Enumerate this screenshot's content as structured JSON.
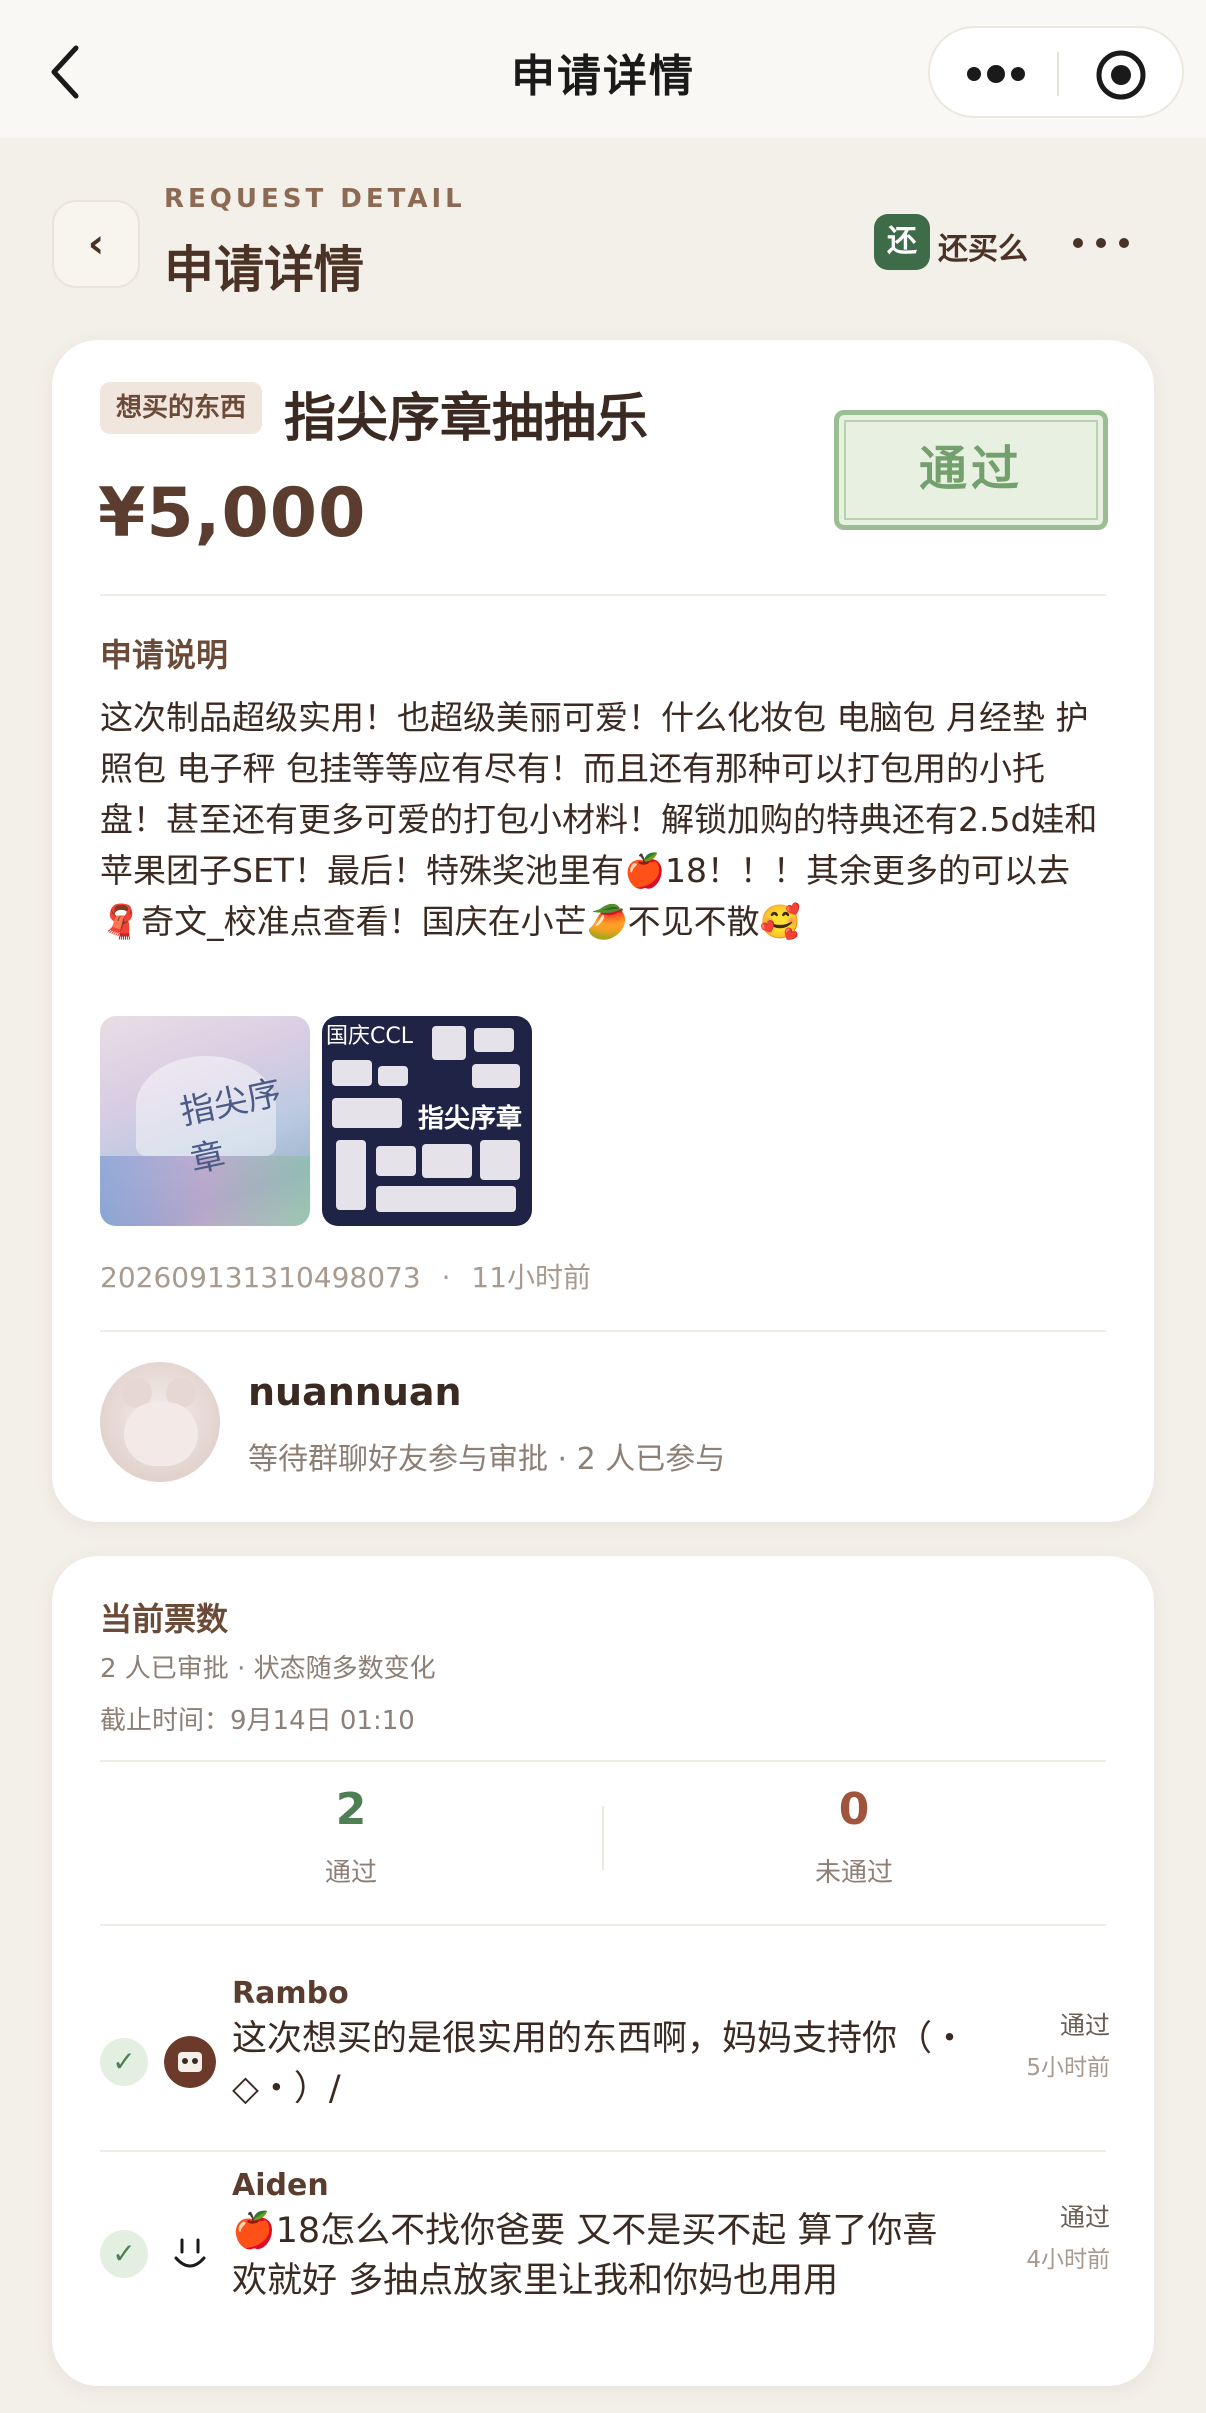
{
  "topnav": {
    "title": "申请详情"
  },
  "header": {
    "subtitle": "REQUEST DETAIL",
    "title": "申请详情",
    "back_label": "‹",
    "app_badge": "还",
    "app_name": "还买么"
  },
  "request": {
    "tag": "想买的东西",
    "item_name": "指尖序章抽抽乐",
    "price": "¥5,000",
    "stamp": "通过",
    "section_label": "申请说明",
    "description": "这次制品超级实用！也超级美丽可爱！什么化妆包 电脑包 月经垫 护照包 电子秤 包挂等等应有尽有！而且还有那种可以打包用的小托盘！甚至还有更多可爱的打包小材料！解锁加购的特典还有2.5d娃和苹果团子SET！最后！特殊奖池里有🍎18！！！其余更多的可以去🧣奇文_校准点查看！国庆在小芒🥭不见不散🥰",
    "thumb1_text": "指尖序章",
    "thumb2_top": "国庆CCL",
    "thumb2_mid": "指尖序章",
    "request_id": "20260913131049807​3",
    "time_ago": "11小时前",
    "meta_sep": "·"
  },
  "applicant": {
    "name": "nuannuan",
    "status": "等待群聊好友参与审批 · 2 人已参与"
  },
  "votes": {
    "title": "当前票数",
    "subtitle": "2 人已审批 · 状态随多数变化",
    "deadline": "截止时间：9月14日 01:10",
    "approve_count": "2",
    "approve_label": "通过",
    "reject_count": "0",
    "reject_label": "未通过",
    "colors": {
      "approve": "#4f7f55",
      "reject": "#a0543e"
    },
    "items": [
      {
        "name": "Rambo",
        "text": "这次想买的是很实用的东西啊，妈妈支持你（・◇・）/",
        "status": "通过",
        "time": "5小时前",
        "check_icon": "✓"
      },
      {
        "name": "Aiden",
        "text": "🍎18怎么不找你爸要 又不是买不起 算了你喜欢就好 多抽点放家里让我和你妈也用用",
        "status": "通过",
        "time": "4小时前",
        "check_icon": "✓"
      }
    ]
  }
}
